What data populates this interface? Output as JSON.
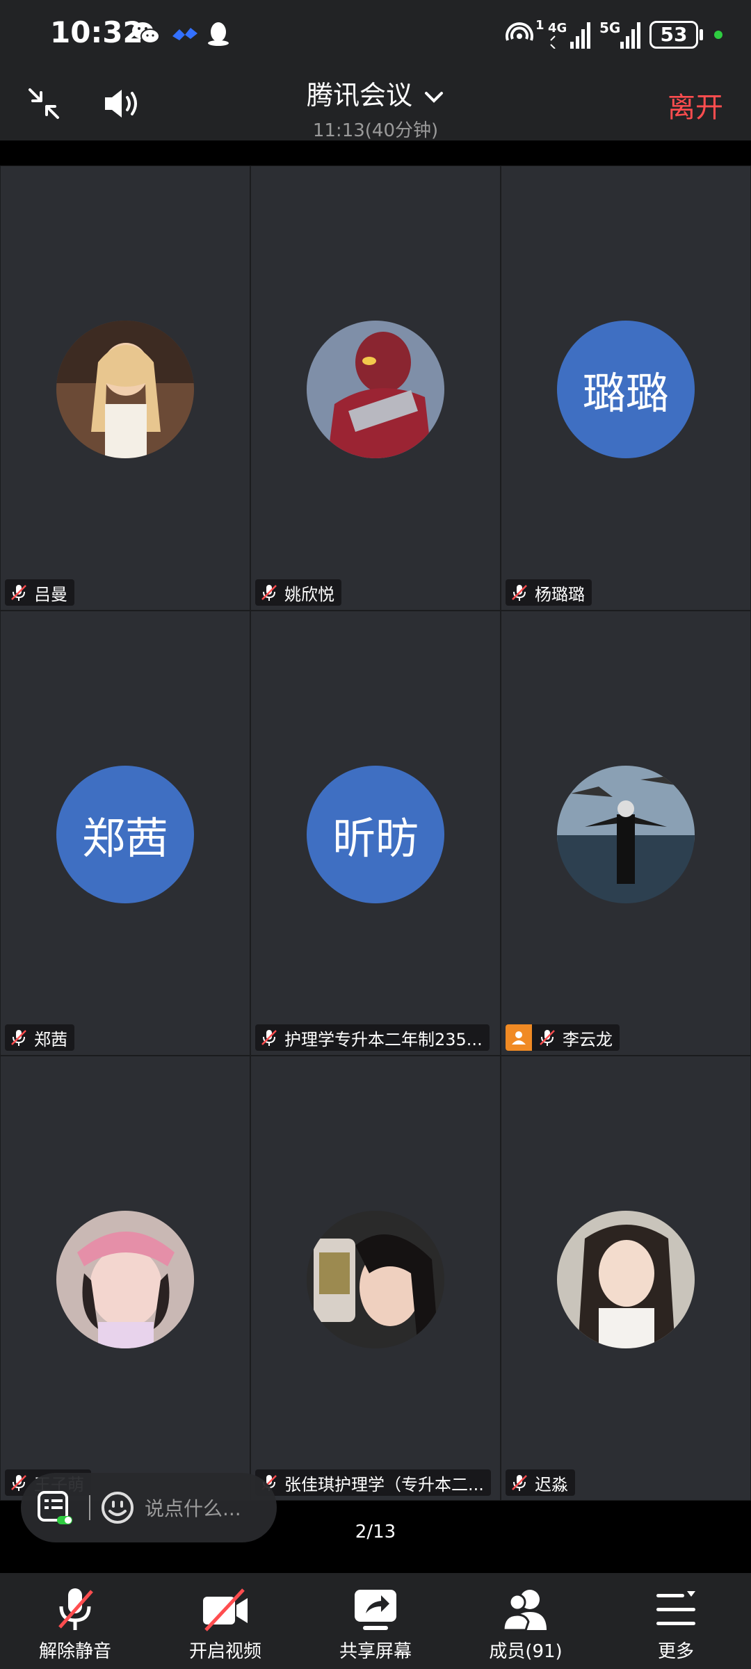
{
  "status_bar": {
    "time": "10:32",
    "battery": "53",
    "signal_1": "4G",
    "signal_2": "5G"
  },
  "header": {
    "title": "腾讯会议",
    "subtitle": "11:13(40分钟)",
    "leave_label": "离开"
  },
  "participants": [
    {
      "name": "吕曼",
      "avatar_text": ""
    },
    {
      "name": "姚欣悦",
      "avatar_text": ""
    },
    {
      "name": "杨璐璐",
      "avatar_text": "璐璐"
    },
    {
      "name": "郑茜",
      "avatar_text": "郑茜"
    },
    {
      "name": "护理学专升本二年制235...",
      "avatar_text": "昕昉"
    },
    {
      "name": "李云龙",
      "avatar_text": ""
    },
    {
      "name": "王子萌",
      "avatar_text": ""
    },
    {
      "name": "张佳琪护理学（专升本二...",
      "avatar_text": ""
    },
    {
      "name": "迟淼",
      "avatar_text": ""
    }
  ],
  "chat": {
    "placeholder": "说点什么..."
  },
  "page_indicator": "2/13",
  "toolbar": {
    "unmute": "解除静音",
    "video": "开启视频",
    "share": "共享屏幕",
    "members": "成员(91)",
    "more": "更多"
  },
  "colors": {
    "accent_leave": "#ff4d4f",
    "avatar_bg": "#3f6fc2",
    "host_badge": "#f08a24",
    "tile_bg": "#2c2e33"
  }
}
